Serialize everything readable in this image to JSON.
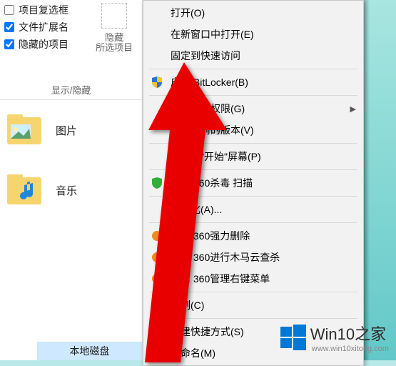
{
  "ribbon": {
    "checkboxes": [
      {
        "label": "项目复选框",
        "checked": false
      },
      {
        "label": "文件扩展名",
        "checked": true
      },
      {
        "label": "隐藏的项目",
        "checked": true
      }
    ],
    "hide_button": {
      "line1": "隐藏",
      "line2": "所选项目"
    },
    "group_label": "显示/隐藏"
  },
  "content": {
    "folders": [
      {
        "name": "图片",
        "icon": "picture-folder"
      },
      {
        "name": "音乐",
        "icon": "music-folder"
      }
    ],
    "selected_item": "本地磁盘"
  },
  "context_menu": {
    "groups": [
      [
        {
          "label": "打开(O)",
          "icon": "",
          "submenu": false
        },
        {
          "label": "在新窗口中打开(E)",
          "icon": "",
          "submenu": false
        },
        {
          "label": "固定到快速访问",
          "icon": "",
          "submenu": false
        }
      ],
      [
        {
          "label": "启用 BitLocker(B)",
          "icon": "shield",
          "submenu": false
        }
      ],
      [
        {
          "label": "授予访问权限(G)",
          "icon": "",
          "submenu": true
        },
        {
          "label": "还原以前的版本(V)",
          "icon": "",
          "submenu": false
        }
      ],
      [
        {
          "label": "固定到\"开始\"屏幕(P)",
          "icon": "",
          "submenu": false
        }
      ],
      [
        {
          "label": "使用 360杀毒 扫描",
          "icon": "360-green",
          "submenu": false
        }
      ],
      [
        {
          "label": "格式化(A)...",
          "icon": "",
          "submenu": false
        }
      ],
      [
        {
          "label": "使用 360强力删除",
          "icon": "360-orange",
          "submenu": false
        },
        {
          "label": "使用 360进行木马云查杀",
          "icon": "360-orange",
          "submenu": false
        },
        {
          "label": "使用 360管理右键菜单",
          "icon": "360-orange",
          "submenu": false
        }
      ],
      [
        {
          "label": "复制(C)",
          "icon": "",
          "submenu": false
        }
      ],
      [
        {
          "label": "创建快捷方式(S)",
          "icon": "",
          "submenu": false
        },
        {
          "label": "重命名(M)",
          "icon": "",
          "submenu": false
        }
      ]
    ]
  },
  "watermark": {
    "title": "Win10之家",
    "url": "www.win10xitong.com"
  },
  "colors": {
    "arrow": "#e80000",
    "selection": "#cde8ff",
    "shield_blue": "#2b74d4",
    "shield_yellow": "#f7c62a",
    "360_green": "#2fae3a",
    "360_orange": "#f08a1d",
    "winlogo": "#0078d6"
  }
}
